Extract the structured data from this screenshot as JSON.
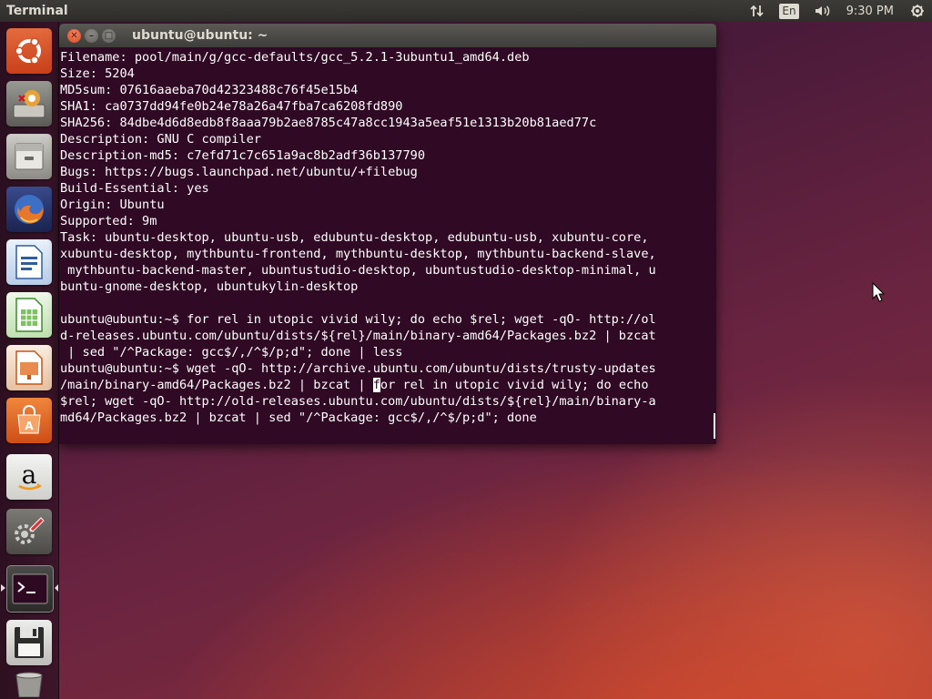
{
  "top_panel": {
    "app_title": "Terminal",
    "keyboard_layout": "En",
    "clock": "9:30 PM",
    "icons": [
      "network-arrows-icon",
      "keyboard-layout-icon",
      "volume-icon",
      "power-gear-icon"
    ]
  },
  "launcher": {
    "items": [
      {
        "name": "ubuntu-dash-icon"
      },
      {
        "name": "ubuntu-installer-icon"
      },
      {
        "name": "files-icon"
      },
      {
        "name": "firefox-icon"
      },
      {
        "name": "libreoffice-writer-icon"
      },
      {
        "name": "libreoffice-calc-icon"
      },
      {
        "name": "libreoffice-impress-icon"
      },
      {
        "name": "ubuntu-software-icon"
      },
      {
        "name": "amazon-icon"
      },
      {
        "name": "system-settings-icon"
      },
      {
        "name": "terminal-icon"
      },
      {
        "name": "save-drive-icon"
      },
      {
        "name": "trash-icon"
      }
    ]
  },
  "terminal": {
    "title": "ubuntu@ubuntu: ~",
    "lines": [
      "Filename: pool/main/g/gcc-defaults/gcc_5.2.1-3ubuntu1_amd64.deb",
      "Size: 5204",
      "MD5sum: 07616aaeba70d42323488c76f45e15b4",
      "SHA1: ca0737dd94fe0b24e78a26a47fba7ca6208fd890",
      "SHA256: 84dbe4d6d8edb8f8aaa79b2ae8785c47a8cc1943a5eaf51e1313b20b81aed77c",
      "Description: GNU C compiler",
      "Description-md5: c7efd71c7c651a9ac8b2adf36b137790",
      "Bugs: https://bugs.launchpad.net/ubuntu/+filebug",
      "Build-Essential: yes",
      "Origin: Ubuntu",
      "Supported: 9m",
      "Task: ubuntu-desktop, ubuntu-usb, edubuntu-desktop, edubuntu-usb, xubuntu-core,",
      "xubuntu-desktop, mythbuntu-frontend, mythbuntu-desktop, mythbuntu-backend-slave,",
      " mythbuntu-backend-master, ubuntustudio-desktop, ubuntustudio-desktop-minimal, u",
      "buntu-gnome-desktop, ubuntukylin-desktop",
      "",
      "ubuntu@ubuntu:~$ for rel in utopic vivid wily; do echo $rel; wget -qO- http://ol",
      "d-releases.ubuntu.com/ubuntu/dists/${rel}/main/binary-amd64/Packages.bz2 | bzcat",
      " | sed \"/^Package: gcc$/,/^$/p;d\"; done | less",
      "ubuntu@ubuntu:~$ wget -qO- http://archive.ubuntu.com/ubuntu/dists/trusty-updates",
      "/main/binary-amd64/Packages.bz2 | bzcat | for rel in utopic vivid wily; do echo",
      "$rel; wget -qO- http://old-releases.ubuntu.com/ubuntu/dists/${rel}/main/binary-a",
      "md64/Packages.bz2 | bzcat | sed \"/^Package: gcc$/,/^$/p;d\"; done"
    ],
    "cursor": {
      "line": 20,
      "col": 42
    }
  }
}
